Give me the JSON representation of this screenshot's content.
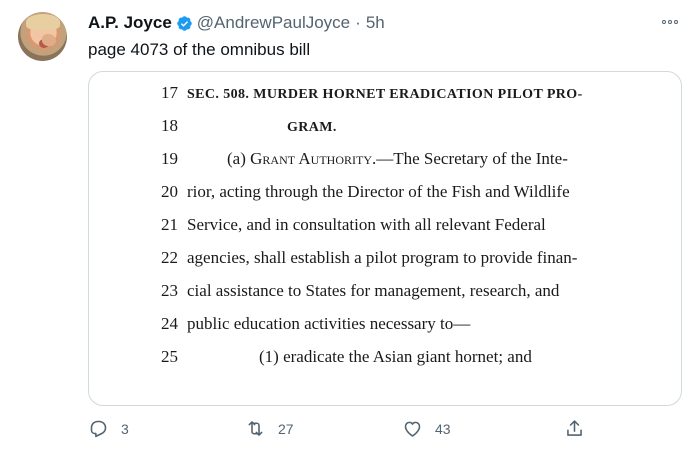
{
  "tweet": {
    "author_name": "A.P. Joyce",
    "handle": "@AndrewPaulJoyce",
    "separator": "·",
    "time": "5h",
    "text": "page 4073 of the omnibus bill"
  },
  "document": {
    "lines": [
      {
        "num": "17",
        "text": "SEC. 508. MURDER HORNET ERADICATION PILOT PRO-",
        "style": "heading"
      },
      {
        "num": "18",
        "text": "GRAM.",
        "style": "heading-indent"
      },
      {
        "num": "19",
        "text_prefix": "(a) ",
        "text_sc": "Grant Authority",
        "text_suffix": ".—The Secretary of the Inte-",
        "style": "indent"
      },
      {
        "num": "20",
        "text": "rior, acting through the Director of the Fish and Wildlife",
        "style": "normal"
      },
      {
        "num": "21",
        "text": "Service, and in consultation with all relevant Federal",
        "style": "normal"
      },
      {
        "num": "22",
        "text": "agencies, shall establish a pilot program to provide finan-",
        "style": "normal"
      },
      {
        "num": "23",
        "text": "cial assistance to States for management, research, and",
        "style": "normal"
      },
      {
        "num": "24",
        "text": "public education activities necessary to—",
        "style": "normal"
      },
      {
        "num": "25",
        "text": "(1) eradicate the Asian giant hornet; and",
        "style": "deep-indent"
      }
    ]
  },
  "actions": {
    "reply_count": "3",
    "retweet_count": "27",
    "like_count": "43"
  },
  "colors": {
    "verified": "#1d9bf0",
    "secondary_text": "#536471"
  },
  "icons": [
    "verified-badge-icon",
    "more-options-icon",
    "reply-icon",
    "retweet-icon",
    "like-icon",
    "share-icon"
  ]
}
